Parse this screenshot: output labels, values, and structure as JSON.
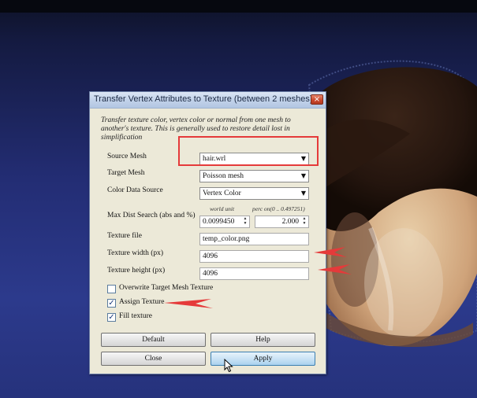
{
  "dialog": {
    "title": "Transfer Vertex Attributes to Texture (between 2 meshes)",
    "close_glyph": "×",
    "description": "Transfer texture color, vertex color or normal from one mesh to another's texture. This is generally used to restore detail lost in simplification",
    "source_mesh": {
      "label": "Source Mesh",
      "value": "hair.wrl"
    },
    "target_mesh": {
      "label": "Target Mesh",
      "value": "Poisson mesh"
    },
    "color_source": {
      "label": "Color Data Source",
      "value": "Vertex Color"
    },
    "max_dist": {
      "label": "Max Dist Search (abs and %)",
      "world_unit_header": "world unit",
      "perc_header": "perc on(0 .. 0.497251)",
      "abs_value": "0.0099450",
      "perc_value": "2.000"
    },
    "texture_file": {
      "label": "Texture file",
      "value": "temp_color.png"
    },
    "texture_width": {
      "label": "Texture width (px)",
      "value": "4096"
    },
    "texture_height": {
      "label": "Texture height (px)",
      "value": "4096"
    },
    "checkboxes": {
      "overwrite": {
        "label": "Overwrite Target Mesh Texture",
        "checked": false
      },
      "assign": {
        "label": "Assign Texture",
        "checked": true
      },
      "fill": {
        "label": "Fill texture",
        "checked": true
      }
    },
    "buttons": {
      "default": "Default",
      "help": "Help",
      "close": "Close",
      "apply": "Apply"
    },
    "check_glyph": "✓",
    "dropdown_glyph": "▼"
  },
  "colors": {
    "annotation_red": "#e53a3a",
    "accent_blue": "#3c7fb1"
  }
}
